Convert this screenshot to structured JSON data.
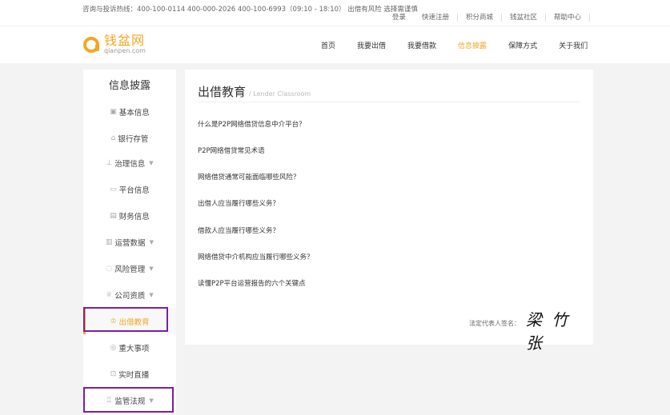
{
  "topbar": {
    "hotline": "咨询与投诉热线：400-100-0114    400-000-2026    400-100-6993（09:10 - 18:10）   出借有风险 选择需谨慎",
    "links": [
      "登录",
      "快速注册",
      "积分商城",
      "钱盆社区",
      "帮助中心"
    ]
  },
  "logo": {
    "cn": "钱盆网",
    "en": "qianpen.com"
  },
  "nav": {
    "items": [
      "首页",
      "我要出借",
      "我要借款",
      "信息披露",
      "保障方式",
      "关于我们"
    ],
    "active": "信息披露",
    "accent": "#f5a623"
  },
  "sidebar": {
    "title": "信息披露",
    "items": [
      {
        "label": "基本信息",
        "icon": "building-icon",
        "dropdown": false
      },
      {
        "label": "银行存管",
        "icon": "bank-icon",
        "dropdown": false
      },
      {
        "label": "治理信息",
        "icon": "org-icon",
        "dropdown": true
      },
      {
        "label": "平台信息",
        "icon": "monitor-icon",
        "dropdown": false
      },
      {
        "label": "财务信息",
        "icon": "chart-icon",
        "dropdown": false
      },
      {
        "label": "运营数据",
        "icon": "data-icon",
        "dropdown": true
      },
      {
        "label": "风险管理",
        "icon": "shield-icon",
        "dropdown": true
      },
      {
        "label": "公司资质",
        "icon": "award-icon",
        "dropdown": true
      },
      {
        "label": "出借教育",
        "icon": "education-icon",
        "dropdown": false,
        "active": true
      },
      {
        "label": "重大事项",
        "icon": "bell-icon",
        "dropdown": false
      },
      {
        "label": "实时直播",
        "icon": "live-icon",
        "dropdown": false
      },
      {
        "label": "监管法规",
        "icon": "law-icon",
        "dropdown": true
      }
    ]
  },
  "content": {
    "title": "出借教育",
    "subtitle": "/ Lender Classroom",
    "articles": [
      "什么是P2P网络借贷信息中介平台？",
      "P2P网络借贷常见术语",
      "网络借贷通常可能面临哪些风险？",
      "出借人应当履行哪些义务？",
      "借款人应当履行哪些义务？",
      "网络借贷中介机构应当履行哪些义务？",
      "读懂P2P平台运营报告的六个关键点"
    ],
    "signature_label": "法定代表人签名：",
    "signature": "梁 竹 张"
  }
}
